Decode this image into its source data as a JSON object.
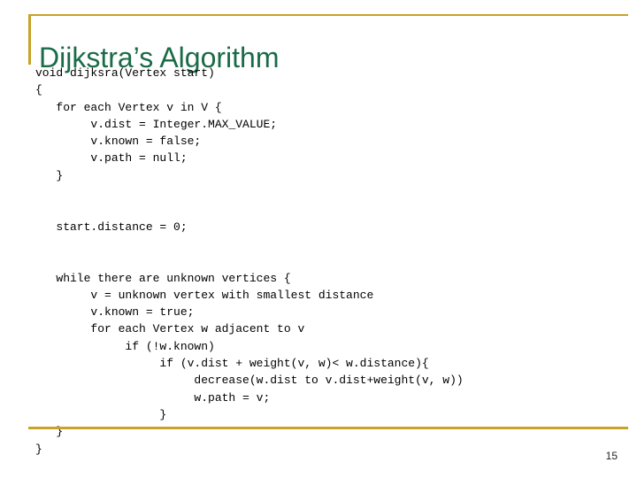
{
  "slide": {
    "title": "Dijkstra’s Algorithm",
    "page_number": "15",
    "accent_color": "#c9a227",
    "title_color": "#1a6b47",
    "code_color": "#000000",
    "background_color": "#ffffff"
  },
  "code": {
    "language": "java-pseudocode",
    "lines": [
      "void dijksra(Vertex start)",
      "{",
      "   for each Vertex v in V {",
      "        v.dist = Integer.MAX_VALUE;",
      "        v.known = false;",
      "        v.path = null;",
      "   }",
      "",
      "",
      "   start.distance = 0;",
      "",
      "",
      "   while there are unknown vertices {",
      "        v = unknown vertex with smallest distance",
      "        v.known = true;",
      "        for each Vertex w adjacent to v",
      "             if (!w.known)",
      "                  if (v.dist + weight(v, w)< w.distance){",
      "                       decrease(w.dist to v.dist+weight(v, w))",
      "                       w.path = v;",
      "                  }",
      "   }",
      "}"
    ]
  }
}
